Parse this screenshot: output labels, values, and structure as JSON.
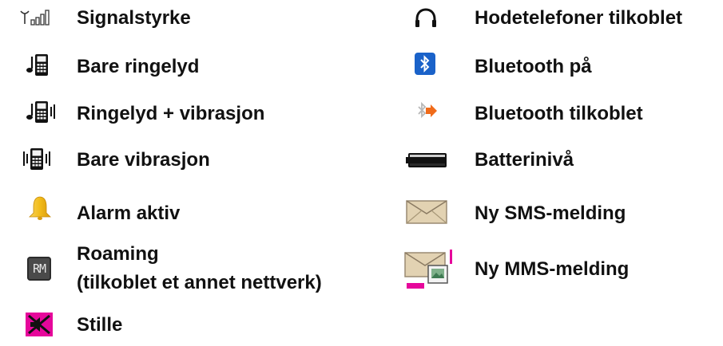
{
  "left": {
    "signal": "Signalstyrke",
    "ring_only": "Bare ringelyd",
    "ring_vibrate": "Ringelyd + vibrasjon",
    "vibrate_only": "Bare vibrasjon",
    "alarm": "Alarm aktiv",
    "roaming_line1": "Roaming",
    "roaming_line2": "(tilkoblet et annet nettverk)",
    "silent": "Stille"
  },
  "right": {
    "headphones": "Hodetelefoner tilkoblet",
    "bluetooth_on": "Bluetooth på",
    "bluetooth_connected": "Bluetooth tilkoblet",
    "battery": "Batterinivå",
    "sms": "Ny SMS-melding",
    "mms": "Ny MMS-melding"
  },
  "icons": {
    "roaming_text": "RM"
  },
  "colors": {
    "bluetooth_blue": "#1a62c9",
    "alarm_yellow": "#f2bb18",
    "silent_magenta": "#e6079b",
    "bluetooth_orange": "#f06b1a",
    "text": "#111111"
  }
}
